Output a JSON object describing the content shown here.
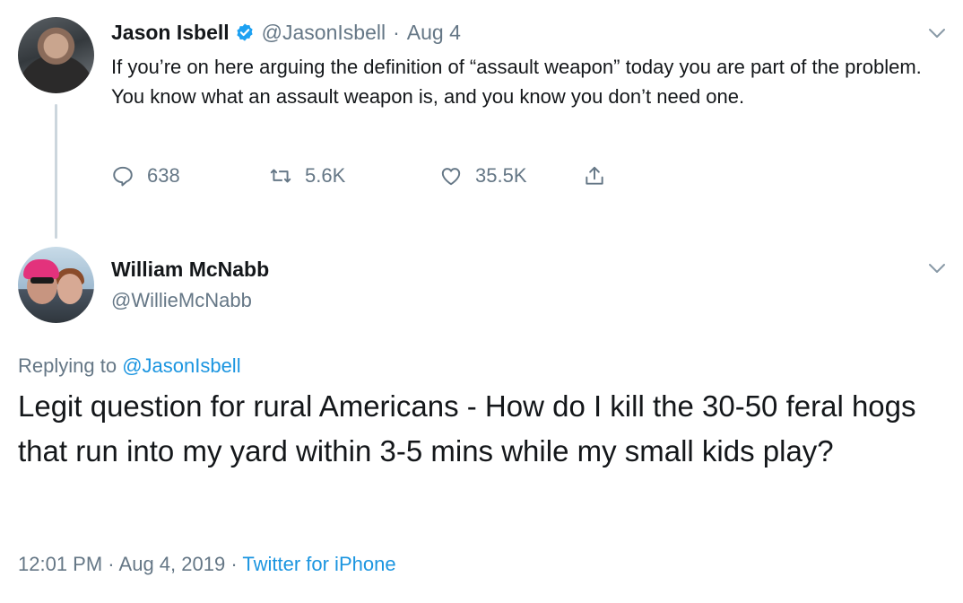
{
  "tweet": {
    "author_name": "Jason Isbell",
    "author_handle": "@JasonIsbell",
    "separator": "·",
    "date": "Aug 4",
    "text": "If you’re on here arguing the definition of “assault weapon” today you are part of the problem. You know what an assault weapon is, and you know you don’t need one.",
    "stats": {
      "replies": "638",
      "retweets": "5.6K",
      "likes": "35.5K"
    },
    "icons": [
      "verified-badge-icon",
      "reply-icon",
      "retweet-icon",
      "like-icon",
      "share-icon",
      "chevron-down-icon"
    ]
  },
  "reply": {
    "author_name": "William McNabb",
    "author_handle": "@WillieMcNabb",
    "replying_prefix": "Replying to ",
    "replying_to": "@JasonIsbell",
    "text": "Legit question for rural Americans - How do I kill the 30-50 feral hogs that run into my yard within 3-5 mins while my small kids play?",
    "time": "12:01 PM",
    "separator": "·",
    "date": "Aug 4, 2019",
    "source": "Twitter for iPhone"
  },
  "colors": {
    "text_primary": "#14171a",
    "text_secondary": "#657786",
    "link": "#1b95e0",
    "verified": "#1da1f2",
    "thread_line": "#ccd6dd"
  }
}
